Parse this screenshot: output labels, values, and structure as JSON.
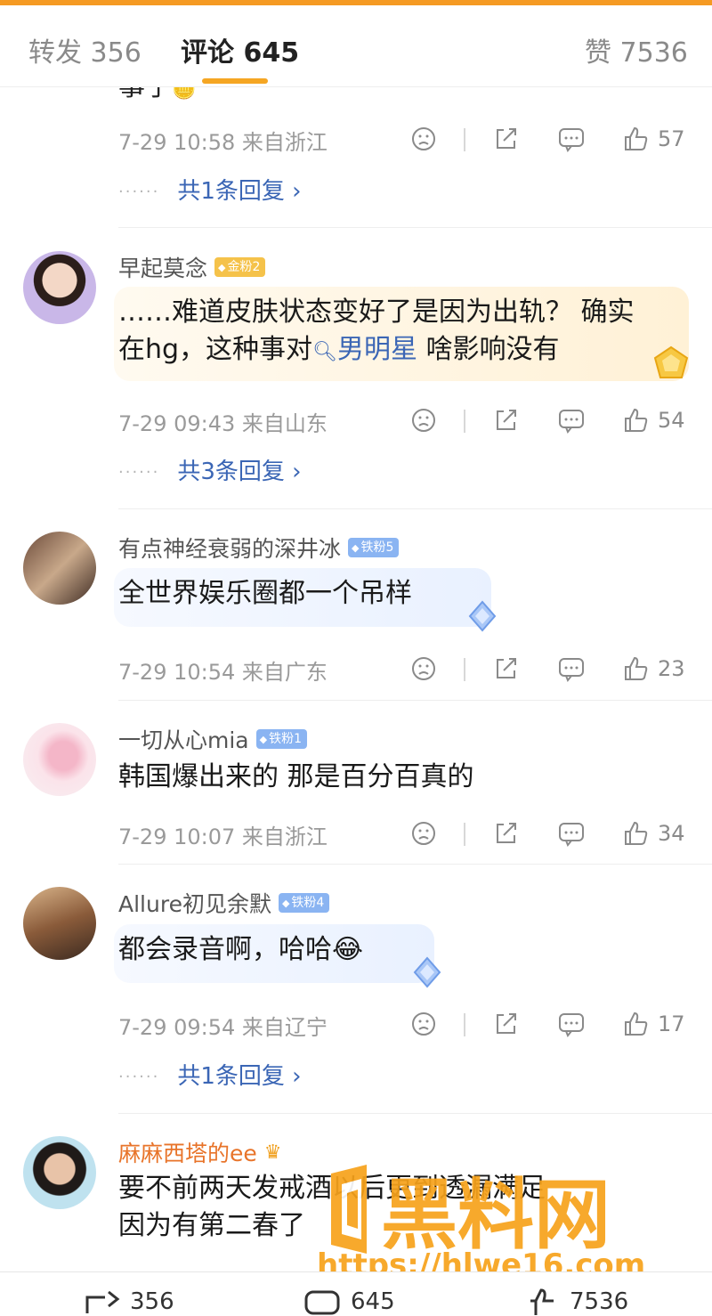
{
  "tabs": [
    {
      "label": "转发 356"
    },
    {
      "label": "评论 645"
    },
    {
      "label": "赞 7536"
    }
  ],
  "prev_comment": {
    "tail": "事了",
    "time": "7-29 10:58 来自浙江",
    "likes": "57",
    "replies": "共1条回复"
  },
  "comments": [
    {
      "user": "早起莫念",
      "badge": "金粉2",
      "line1": "……难道皮肤状态变好了是因为出轨？ 确实",
      "line2_a": "在hg，这种事对",
      "link": "男明星",
      "line2_b": " 啥影响没有",
      "time": "7-29 09:43 来自山东",
      "likes": "54",
      "replies": "共3条回复"
    },
    {
      "user": "有点神经衰弱的深井冰",
      "badge": "铁粉5",
      "text": "全世界娱乐圈都一个吊样",
      "time": "7-29 10:54 来自广东",
      "likes": "23"
    },
    {
      "user": "一切从心mia",
      "badge": "铁粉1",
      "text": "韩国爆出来的  那是百分百真的",
      "time": "7-29 10:07 来自浙江",
      "likes": "34"
    },
    {
      "user": "Allure初见余默",
      "badge": "铁粉4",
      "text": "都会录音啊，哈哈😂",
      "time": "7-29 09:54 来自辽宁",
      "likes": "17",
      "replies": "共1条回复"
    },
    {
      "user": "麻麻西塔的ee",
      "line1": "要不前两天发戒酒以后更到透漏满足",
      "line2": "因为有第二春了"
    }
  ],
  "bottom_bar": {
    "repost": "356",
    "comment": "645",
    "like": "7536"
  },
  "watermark": {
    "title": "黑料网",
    "url": "https://hlwe16.com"
  },
  "colors": {
    "accent": "#f5a623",
    "link": "#3b66b5",
    "vip_name": "#e8742a"
  }
}
